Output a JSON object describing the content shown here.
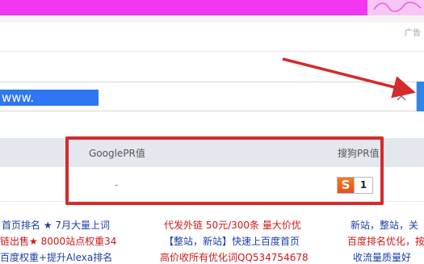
{
  "top": {
    "ad_label": "广告"
  },
  "search": {
    "value": "www.",
    "placeholder": ""
  },
  "table": {
    "header": {
      "google": "GooglePR值",
      "sogou": "搜狗PR值"
    },
    "row": {
      "google_value": "-",
      "sogou_value": "1",
      "sogou_letter": "S"
    }
  },
  "ads": {
    "col1": [
      {
        "a": "首页排名 ",
        "star": "★",
        "b": " 7月大量上词"
      },
      {
        "a": "链出售",
        "star": "★",
        "b": " 8000站点权重34"
      },
      {
        "a": "百度权重+提升Alexa排名"
      }
    ],
    "col2": [
      "代发外链 50元/300条 量大价优",
      "【整站，新站】快速上百度首页",
      "高价收所有优化词QQ534754678"
    ],
    "col3": [
      "新站，整站，关",
      "百度排名优化，按",
      "收流量质量好"
    ]
  },
  "colors": {
    "top_bar": "#f236f2",
    "highlight": "#d42b2b",
    "search_button": "#2f86e8"
  }
}
